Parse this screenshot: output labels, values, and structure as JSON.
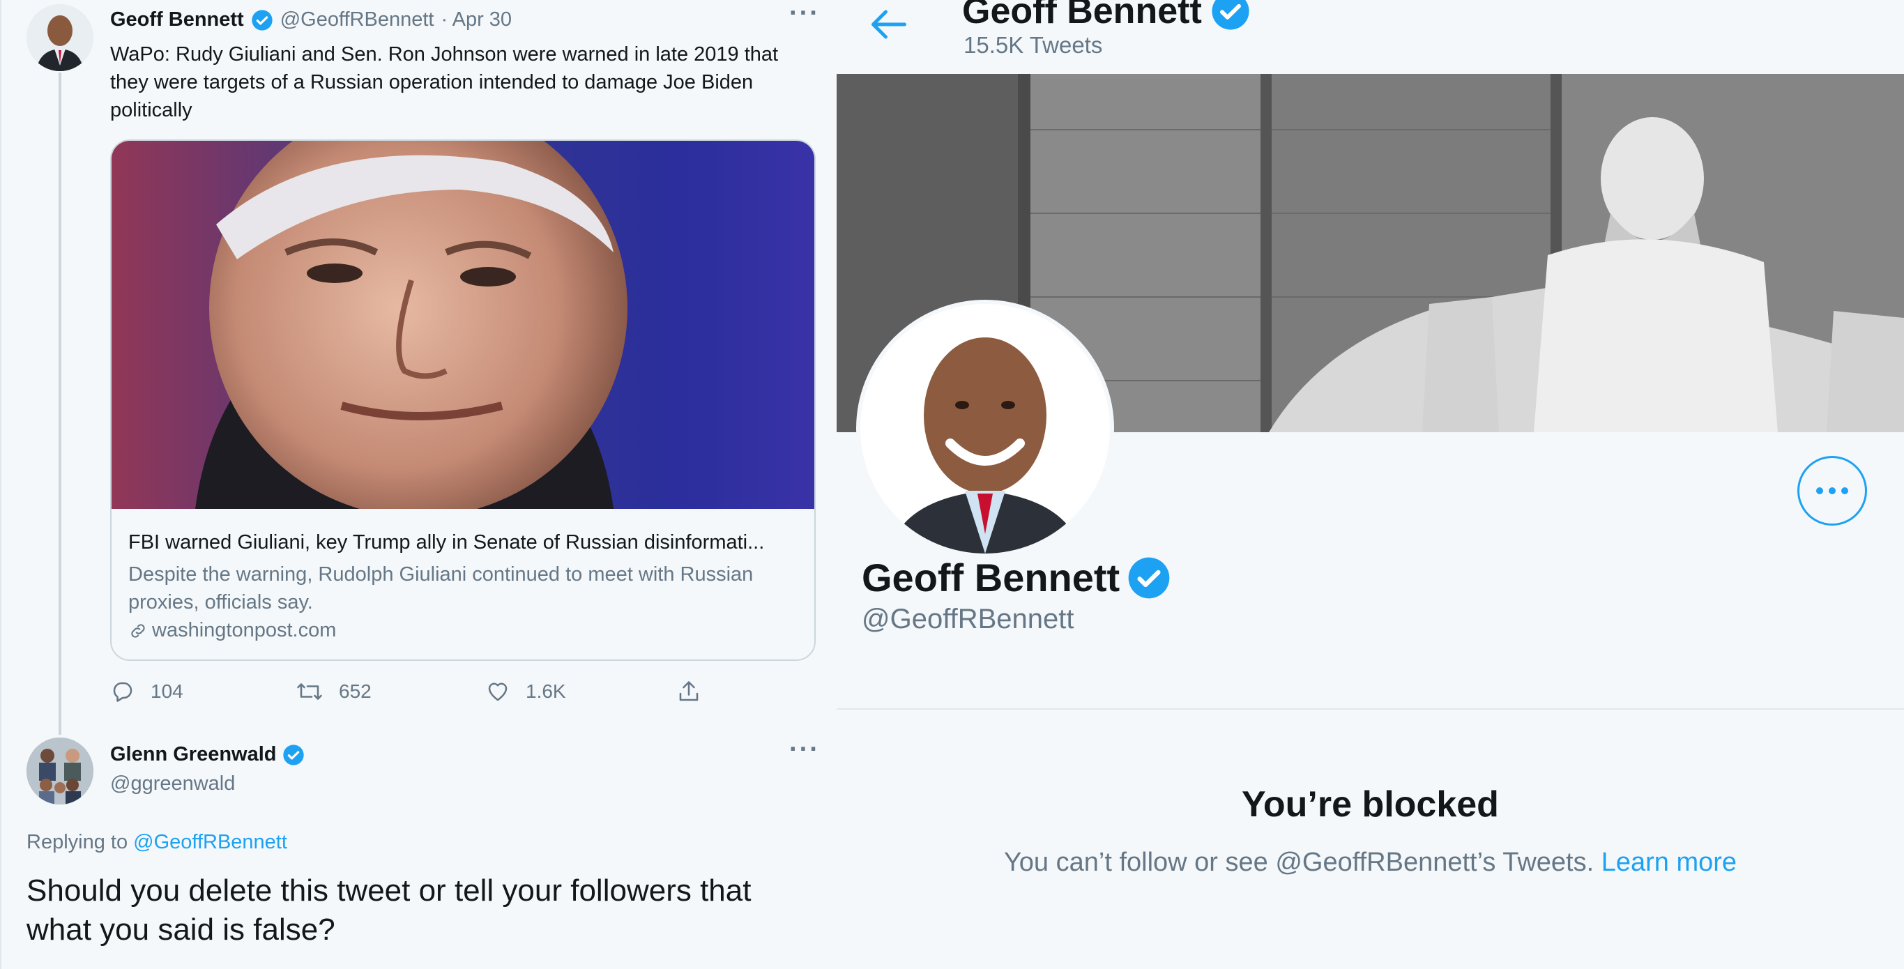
{
  "tweet": {
    "author_name": "Geoff Bennett",
    "handle": "@GeoffRBennett",
    "date": "· Apr 30",
    "text": "WaPo: Rudy Giuliani and Sen. Ron Johnson were warned in late 2019 that they were targets of a Russian operation intended to damage Joe Biden politically",
    "card": {
      "title": "FBI warned Giuliani, key Trump ally in Senate of Russian disinformati...",
      "description": "Despite the warning, Rudolph Giuliani continued to meet with Russian proxies, officials say.",
      "domain": "washingtonpost.com"
    },
    "replies": "104",
    "retweets": "652",
    "likes": "1.6K"
  },
  "reply": {
    "author_name": "Glenn Greenwald",
    "handle": "@ggreenwald",
    "replying_label": "Replying to",
    "replying_handle": "@GeoffRBennett",
    "text": "Should you delete this tweet or tell your followers that what you said is false?"
  },
  "profile": {
    "header_name": "Geoff Bennett",
    "tweet_count": "15.5K Tweets",
    "name": "Geoff Bennett",
    "handle": "@GeoffRBennett",
    "blocked_title": "You’re blocked",
    "blocked_text": "You can’t follow or see @GeoffRBennett’s Tweets.",
    "learn_more": "Learn more"
  },
  "colors": {
    "accent": "#1da1f2",
    "muted": "#657786",
    "text": "#14171a",
    "border": "#ccd6dd"
  }
}
